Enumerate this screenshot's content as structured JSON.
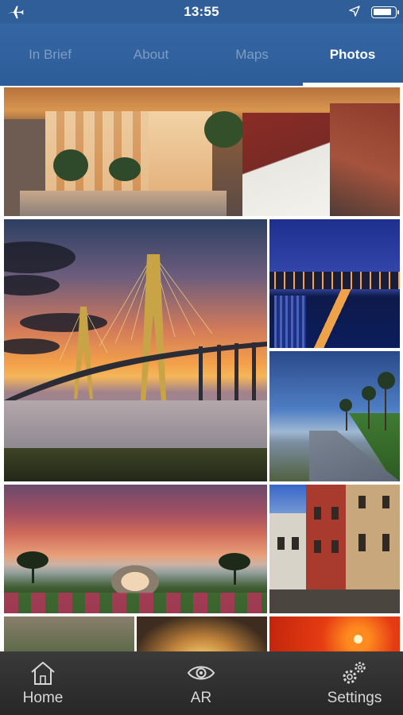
{
  "status_bar": {
    "time": "13:55",
    "icons": [
      "airplane-icon",
      "location-arrow-icon",
      "battery-icon"
    ]
  },
  "tabs": [
    {
      "label": "In Brief",
      "active": false
    },
    {
      "label": "About",
      "active": false
    },
    {
      "label": "Maps",
      "active": false
    },
    {
      "label": "Photos",
      "active": true
    }
  ],
  "colors": {
    "header": "#2f5e98",
    "tab_inactive": "#7f9cc3",
    "tab_active": "#ffffff",
    "bottom_bar": "#2e2e2e"
  },
  "photos": [
    {
      "subject": "city rooftops"
    },
    {
      "subject": "cable-stayed bridge at sunset"
    },
    {
      "subject": "harbor at night"
    },
    {
      "subject": "waterfront promenade with palms"
    },
    {
      "subject": "fountain park at sunset"
    },
    {
      "subject": "colorful row houses"
    },
    {
      "subject": "flag over building"
    },
    {
      "subject": "sunburst interior"
    },
    {
      "subject": "orange sun over water"
    }
  ],
  "bottom_bar": {
    "items": [
      {
        "label": "Home",
        "icon": "home-icon"
      },
      {
        "label": "AR",
        "icon": "eye-icon"
      },
      {
        "label": "Settings",
        "icon": "gears-icon"
      }
    ]
  }
}
